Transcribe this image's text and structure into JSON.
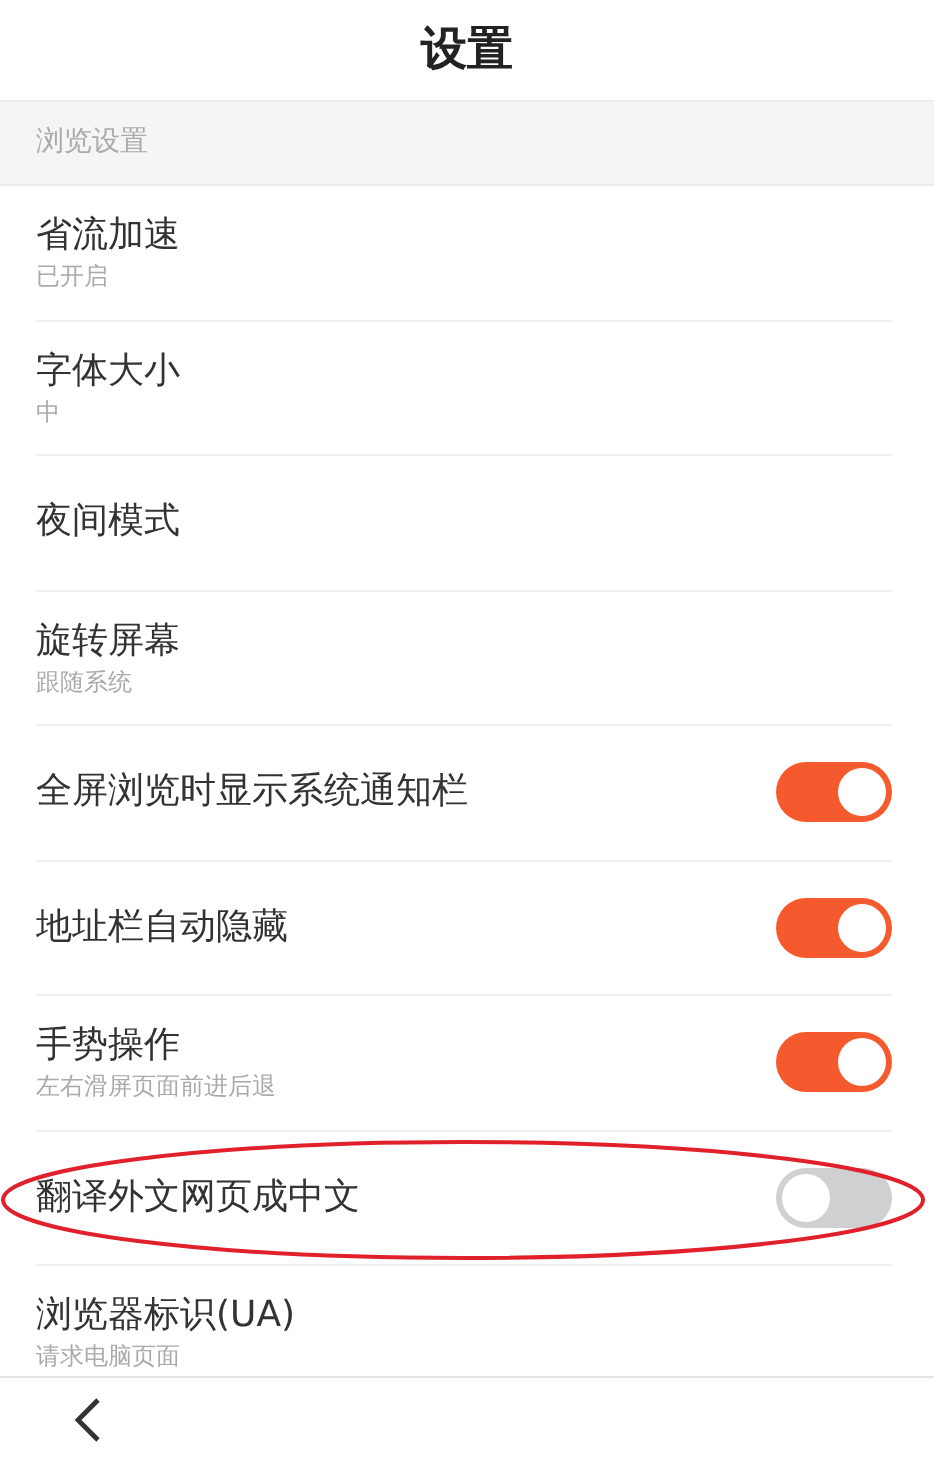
{
  "title": "设置",
  "section": "浏览设置",
  "items": [
    {
      "kind": "plain",
      "label": "省流加速",
      "subtitle": "已开启"
    },
    {
      "kind": "plain",
      "label": "字体大小",
      "subtitle": "中"
    },
    {
      "kind": "plain",
      "label": "夜间模式"
    },
    {
      "kind": "plain",
      "label": "旋转屏幕",
      "subtitle": "跟随系统"
    },
    {
      "kind": "toggle",
      "label": "全屏浏览时显示系统通知栏",
      "on": true
    },
    {
      "kind": "toggle",
      "label": "地址栏自动隐藏",
      "on": true
    },
    {
      "kind": "toggle",
      "label": "手势操作",
      "subtitle": "左右滑屏页面前进后退",
      "on": true
    },
    {
      "kind": "toggle",
      "label": "翻译外文网页成中文",
      "on": false,
      "circled": true
    },
    {
      "kind": "plain",
      "label": "浏览器标识(UA)",
      "subtitle": "请求电脑页面"
    }
  ]
}
